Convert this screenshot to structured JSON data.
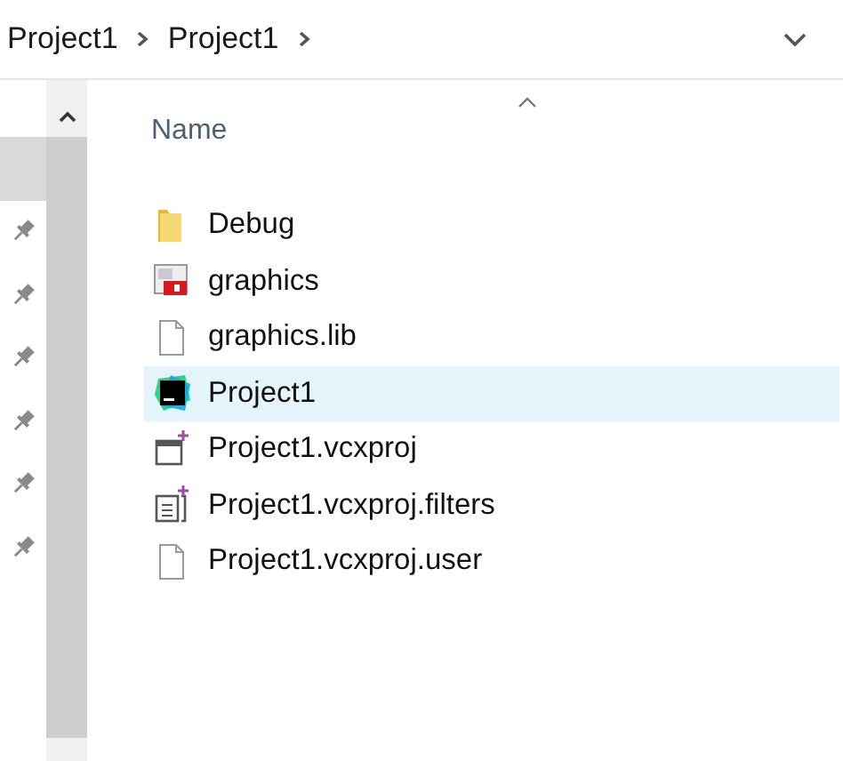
{
  "breadcrumb": [
    {
      "label": "Project1"
    },
    {
      "label": "Project1"
    }
  ],
  "column_header": {
    "label": "Name"
  },
  "files": [
    {
      "name": "Debug",
      "kind": "folder",
      "selected": false
    },
    {
      "name": "graphics",
      "kind": "header",
      "selected": false
    },
    {
      "name": "graphics.lib",
      "kind": "file",
      "selected": false
    },
    {
      "name": "Project1",
      "kind": "app",
      "selected": true
    },
    {
      "name": "Project1.vcxproj",
      "kind": "project",
      "selected": false
    },
    {
      "name": "Project1.vcxproj.filters",
      "kind": "filters",
      "selected": false
    },
    {
      "name": "Project1.vcxproj.user",
      "kind": "file",
      "selected": false
    }
  ],
  "nav_pane": {
    "pinned_items": [
      {
        "highlighted": true,
        "pinned": false
      },
      {
        "highlighted": false,
        "pinned": true
      },
      {
        "highlighted": false,
        "pinned": true
      },
      {
        "highlighted": false,
        "pinned": true
      },
      {
        "highlighted": false,
        "pinned": true
      },
      {
        "highlighted": false,
        "pinned": true
      },
      {
        "highlighted": false,
        "pinned": true
      }
    ]
  }
}
